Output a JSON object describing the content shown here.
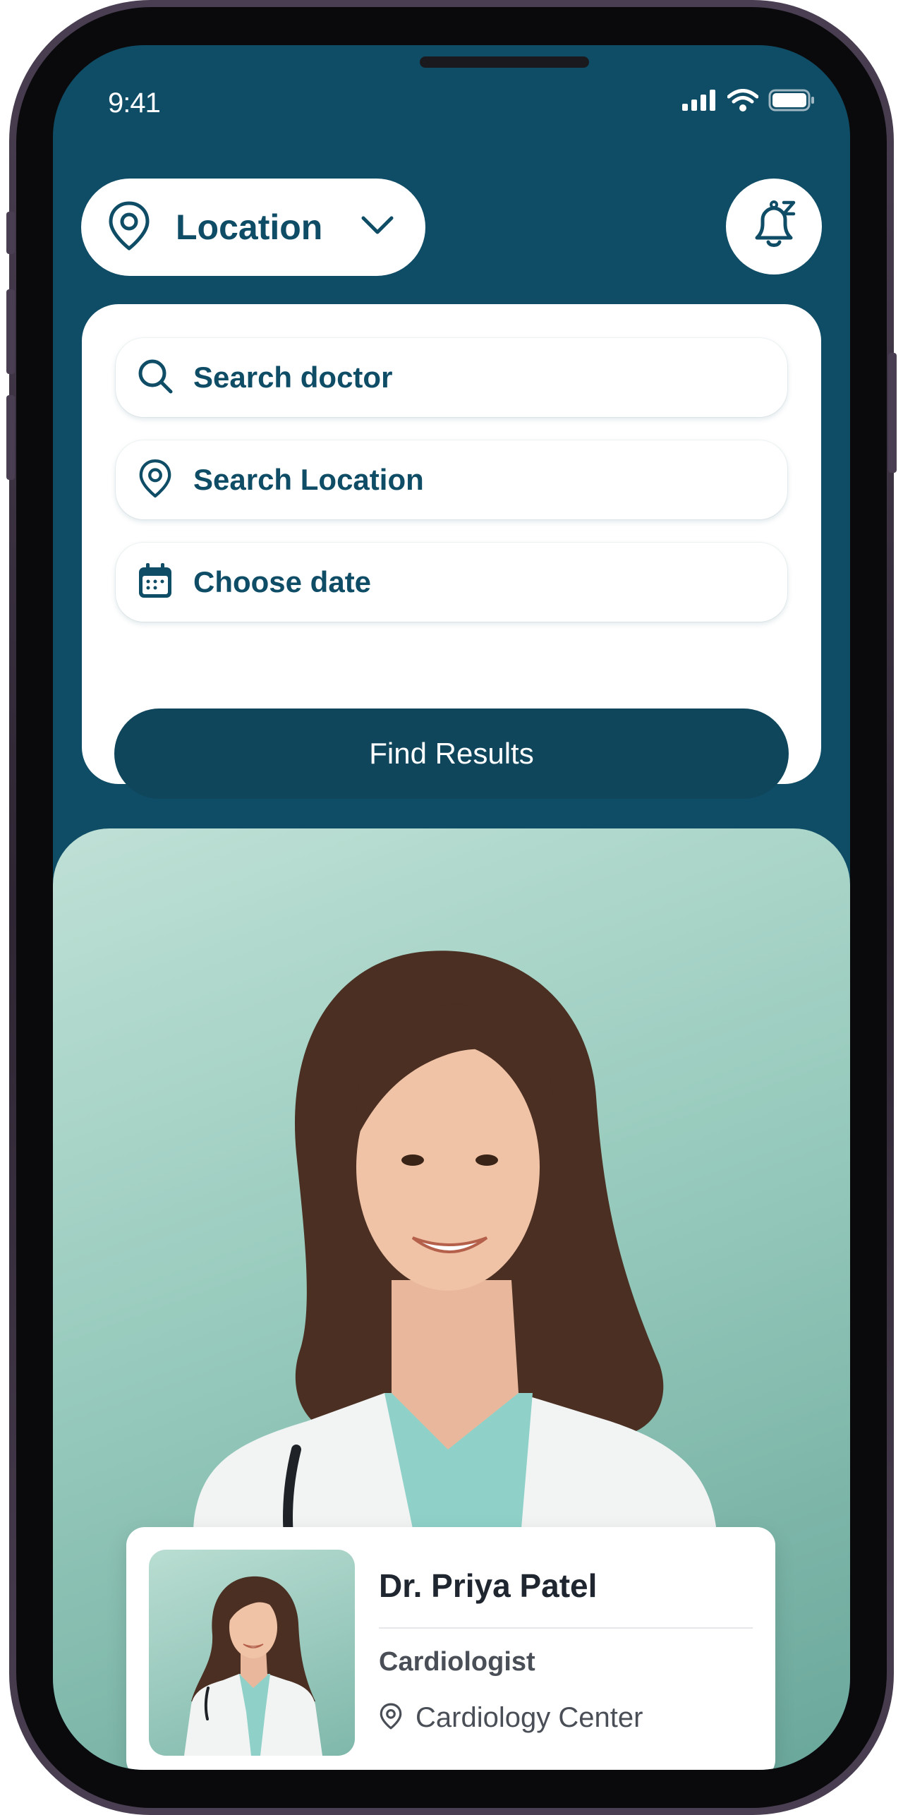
{
  "status_bar": {
    "time": "9:41"
  },
  "header": {
    "location_label": "Location"
  },
  "search": {
    "doctor_placeholder": "Search doctor",
    "location_placeholder": "Search Location",
    "date_placeholder": "Choose date",
    "find_button": "Find Results"
  },
  "featured_doctor": {
    "name": "Dr. Priya Patel",
    "specialty": "Cardiologist",
    "location": "Cardiology Center"
  },
  "colors": {
    "primary": "#0f4c66",
    "button": "#10465c",
    "hero_background": "#98cbbd"
  },
  "icons": [
    "map-pin-icon",
    "chevron-down-icon",
    "bell-snooze-icon",
    "search-icon",
    "calendar-icon",
    "signal-icon",
    "wifi-icon",
    "battery-icon"
  ]
}
